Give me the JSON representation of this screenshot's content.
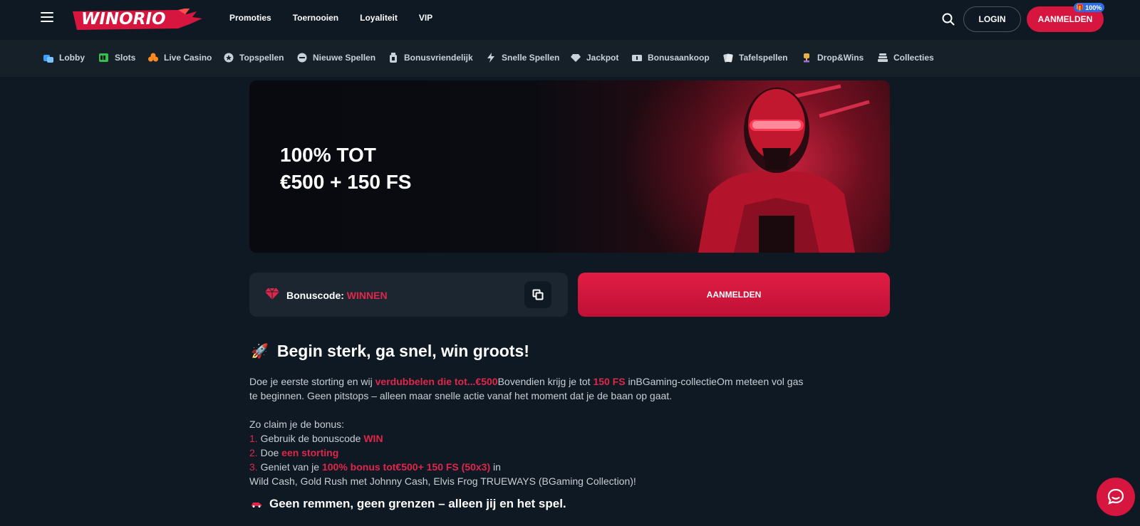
{
  "header": {
    "logo_text": "WINORIO",
    "nav": [
      "Promoties",
      "Toernooien",
      "Loyaliteit",
      "VIP"
    ],
    "login_label": "LOGIN",
    "signup_label": "AANMELDEN",
    "signup_badge": "100%"
  },
  "categories": [
    {
      "label": "Lobby",
      "icon": "lobby-icon"
    },
    {
      "label": "Slots",
      "icon": "slots-icon"
    },
    {
      "label": "Live Casino",
      "icon": "live-casino-icon"
    },
    {
      "label": "Topspellen",
      "icon": "star-icon"
    },
    {
      "label": "Nieuwe Spellen",
      "icon": "new-icon"
    },
    {
      "label": "Bonusvriendelijk",
      "icon": "bonus-icon"
    },
    {
      "label": "Snelle Spellen",
      "icon": "lightning-icon"
    },
    {
      "label": "Jackpot",
      "icon": "diamond-icon"
    },
    {
      "label": "Bonusaankoop",
      "icon": "ticket-icon"
    },
    {
      "label": "Tafelspellen",
      "icon": "cards-icon"
    },
    {
      "label": "Drop&Wins",
      "icon": "trophy-icon"
    },
    {
      "label": "Collecties",
      "icon": "stack-icon"
    }
  ],
  "hero": {
    "line1": "100% TOT",
    "line2": "€500 + 150 FS"
  },
  "bonus": {
    "label": "Bonuscode:",
    "code": "WINNEN",
    "cta": "AANMELDEN"
  },
  "content": {
    "heading_emoji": "🚀",
    "heading": "Begin sterk, ga snel, win groots!",
    "p1": {
      "a": "Doe je eerste storting en wij ",
      "b": "verdubbelen die tot...€500",
      "c": "Bovendien krijg je tot ",
      "d": "150 FS",
      "e": " inBGaming-collectieOm meteen vol gas",
      "f": "te beginnen. Geen pitstops – alleen maar snelle actie vanaf het moment dat je de baan op gaat."
    },
    "steps_intro": "Zo claim je de bonus:",
    "step1": {
      "n": "1.",
      "a": " Gebruik de bonuscode ",
      "b": "WIN"
    },
    "step2": {
      "n": "2.",
      "a": " Doe ",
      "b": "een storting"
    },
    "step3": {
      "n": "3.",
      "a": " Geniet van je ",
      "b": "100% bonus tot€500+ 150 FS (50x3)",
      "c": " in"
    },
    "games_line": "Wild Cash, Gold Rush met Johnny Cash, Elvis Frog TRUEWAYS (BGaming Collection)!",
    "sub_heading": "Geen remmen, geen grenzen – alleen jij en het spel."
  },
  "colors": {
    "accent": "#d6163e",
    "background": "#0f1923",
    "panel": "#1b2630"
  }
}
